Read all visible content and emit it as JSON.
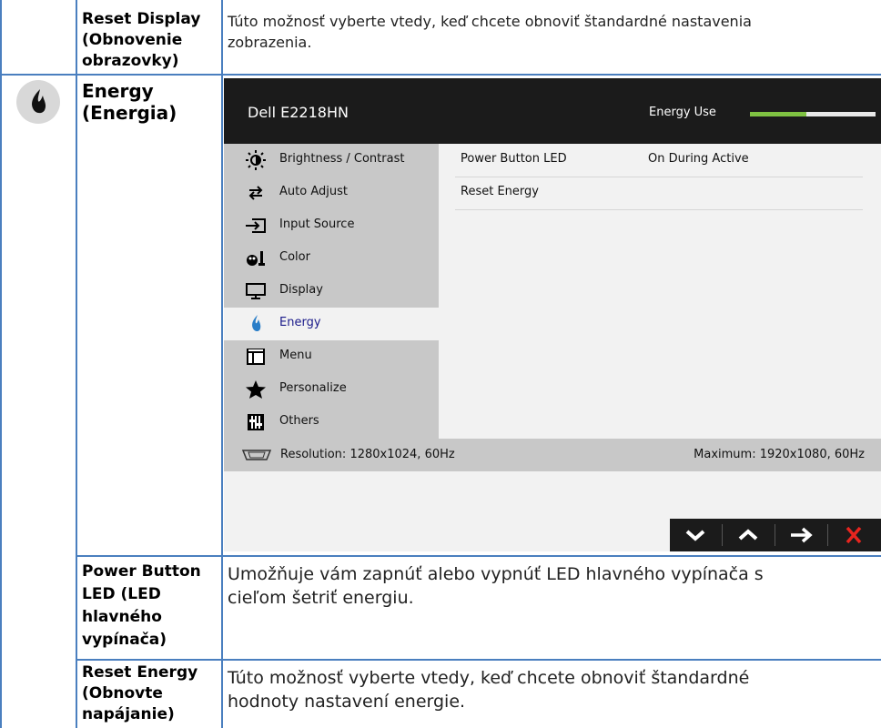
{
  "rows": [
    {
      "title_lines": [
        "Reset Display",
        "(Obnovenie",
        "obrazovky)"
      ],
      "desc_lines": [
        "Túto možnosť vyberte vtedy, keď chcete obnoviť štandardné nastavenia",
        "zobrazenia."
      ]
    },
    {
      "title_lines": [
        "Energy",
        "(Energia)"
      ],
      "icon": "energy-drop-icon"
    },
    {
      "title_lines": [
        "Power Button",
        "LED (LED",
        "hlavného",
        "vypínača)"
      ],
      "desc_lines": [
        "Umožňuje vám zapnúť alebo vypnúť LED hlavného vypínača s",
        "cieľom šetriť energiu."
      ]
    },
    {
      "title_lines": [
        "Reset Energy",
        "(Obnovte",
        "napájanie)"
      ],
      "desc_lines": [
        "Túto možnosť vyberte vtedy, keď chcete obnoviť štandardné",
        "hodnoty nastavení energie."
      ]
    }
  ],
  "osd": {
    "model": "Dell E2218HN",
    "energy_use_label": "Energy Use",
    "energy_use_level": 0.45,
    "menu": [
      {
        "label": "Brightness / Contrast",
        "icon": "brightness-icon"
      },
      {
        "label": "Auto Adjust",
        "icon": "auto-adjust-icon"
      },
      {
        "label": "Input Source",
        "icon": "input-source-icon"
      },
      {
        "label": "Color",
        "icon": "color-icon"
      },
      {
        "label": "Display",
        "icon": "display-icon"
      },
      {
        "label": "Energy",
        "icon": "energy-icon",
        "selected": true
      },
      {
        "label": "Menu",
        "icon": "menu-icon"
      },
      {
        "label": "Personalize",
        "icon": "star-icon"
      },
      {
        "label": "Others",
        "icon": "others-icon"
      }
    ],
    "submenu": [
      {
        "label": "Power Button LED",
        "value": "On During Active"
      },
      {
        "label": "Reset Energy",
        "value": ""
      }
    ],
    "resolution": "Resolution: 1280x1024, 60Hz",
    "maximum": "Maximum: 1920x1080, 60Hz",
    "buttons": [
      "chevron-down-icon",
      "chevron-up-icon",
      "arrow-right-icon",
      "close-icon"
    ]
  }
}
